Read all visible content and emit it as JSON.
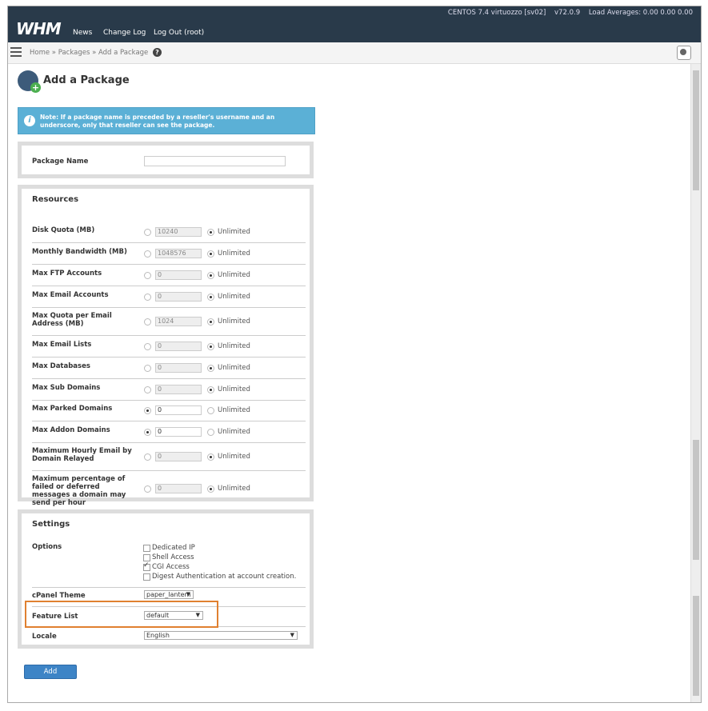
{
  "header": {
    "logo": "WHM",
    "nav": [
      "News",
      "Change Log",
      "Log Out (root)"
    ],
    "os": "CENTOS 7.4 virtuozzo [sv02]",
    "version": "v72.0.9",
    "load": "Load Averages: 0.00 0.00 0.00"
  },
  "breadcrumb": {
    "text": "Home » Packages » Add a Package",
    "help": "?"
  },
  "page": {
    "title": "Add a Package",
    "note": "Note: If a package name is preceded by a reseller's username and an underscore, only that reseller can see the package."
  },
  "package_name": {
    "label": "Package Name",
    "value": ""
  },
  "resources": {
    "heading": "Resources",
    "unlimited_label": "Unlimited",
    "rows": [
      {
        "label": "Disk Quota (MB)",
        "value": "10240",
        "unlimited": true
      },
      {
        "label": "Monthly Bandwidth (MB)",
        "value": "1048576",
        "unlimited": true
      },
      {
        "label": "Max FTP Accounts",
        "value": "0",
        "unlimited": true
      },
      {
        "label": "Max Email Accounts",
        "value": "0",
        "unlimited": true
      },
      {
        "label": "Max Quota per Email Address (MB)",
        "value": "1024",
        "unlimited": true
      },
      {
        "label": "Max Email Lists",
        "value": "0",
        "unlimited": true
      },
      {
        "label": "Max Databases",
        "value": "0",
        "unlimited": true
      },
      {
        "label": "Max Sub Domains",
        "value": "0",
        "unlimited": true
      },
      {
        "label": "Max Parked Domains",
        "value": "0",
        "unlimited": false
      },
      {
        "label": "Max Addon Domains",
        "value": "0",
        "unlimited": false
      },
      {
        "label": "Maximum Hourly Email by Domain Relayed",
        "value": "0",
        "unlimited": true
      },
      {
        "label": "Maximum percentage of failed or deferred messages a domain may send per hour",
        "value": "0",
        "unlimited": true
      }
    ]
  },
  "settings": {
    "heading": "Settings",
    "options_label": "Options",
    "options": [
      {
        "label": "Dedicated IP",
        "checked": false
      },
      {
        "label": "Shell Access",
        "checked": false
      },
      {
        "label": "CGI Access",
        "checked": true
      },
      {
        "label": "Digest Authentication at account creation.",
        "checked": false
      }
    ],
    "theme_label": "cPanel Theme",
    "theme_value": "paper_lantern",
    "feature_label": "Feature List",
    "feature_value": "default",
    "locale_label": "Locale",
    "locale_value": "English"
  },
  "add_button": "Add"
}
